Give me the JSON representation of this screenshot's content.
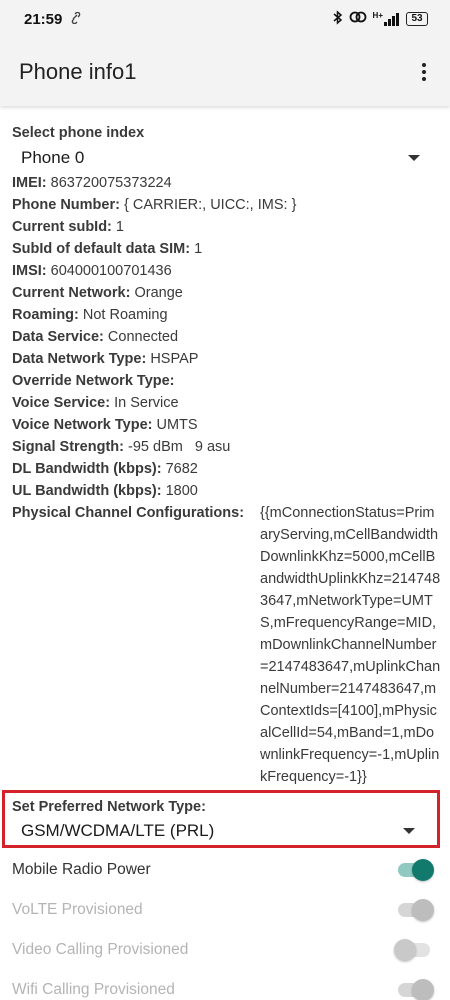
{
  "status_bar": {
    "time": "21:59",
    "network_label": "H+",
    "battery": "53",
    "icons": [
      "link-icon",
      "bluetooth-icon",
      "hotspot-icon",
      "signal-icon",
      "battery-icon"
    ]
  },
  "app_bar": {
    "title": "Phone info1",
    "menu_icon": "more-vert-icon"
  },
  "phone_index": {
    "label": "Select phone index",
    "selected": "Phone 0"
  },
  "info": [
    {
      "label": "IMEI:",
      "value": "863720075373224"
    },
    {
      "label": "Phone Number:",
      "value": " { CARRIER:, UICC:, IMS: }"
    },
    {
      "label": "Current subId:",
      "value": "1"
    },
    {
      "label": "SubId of default data SIM:",
      "value": "1"
    },
    {
      "label": "IMSI:",
      "value": "604000100701436"
    },
    {
      "label": "Current Network:",
      "value": "Orange"
    },
    {
      "label": "Roaming:",
      "value": "Not Roaming"
    },
    {
      "label": "Data Service:",
      "value": "Connected"
    },
    {
      "label": "Data Network Type:",
      "value": "HSPAP"
    },
    {
      "label": "Override Network Type:",
      "value": ""
    },
    {
      "label": "Voice Service:",
      "value": "In Service"
    },
    {
      "label": "Voice Network Type:",
      "value": "UMTS"
    },
    {
      "label": "Signal Strength:",
      "value": "-95 dBm   9 asu"
    },
    {
      "label": "DL Bandwidth (kbps):",
      "value": "7682"
    },
    {
      "label": "UL Bandwidth (kbps):",
      "value": "1800"
    }
  ],
  "physical_channel": {
    "label": "Physical Channel Configurations:",
    "value": "{{mConnectionStatus=PrimaryServing,mCellBandwidthDownlinkKhz=5000,mCellBandwidthUplinkKhz=2147483647,mNetworkType=UMTS,mFrequencyRange=MID,mDownlinkChannelNumber=2147483647,mUplinkChannelNumber=2147483647,mContextIds=[4100],mPhysicalCellId=54,mBand=1,mDownlinkFrequency=-1,mUplinkFrequency=-1}}"
  },
  "preferred_network": {
    "label": "Set Preferred Network Type:",
    "selected": "GSM/WCDMA/LTE (PRL)"
  },
  "toggles": [
    {
      "label": "Mobile Radio Power",
      "state": "on",
      "enabled": true
    },
    {
      "label": "VoLTE Provisioned",
      "state": "on",
      "enabled": false
    },
    {
      "label": "Video Calling Provisioned",
      "state": "off",
      "enabled": false
    },
    {
      "label": "Wifi Calling Provisioned",
      "state": "on",
      "enabled": false
    }
  ],
  "colors": {
    "highlight": "#d3222a",
    "accent": "#127a6c"
  }
}
